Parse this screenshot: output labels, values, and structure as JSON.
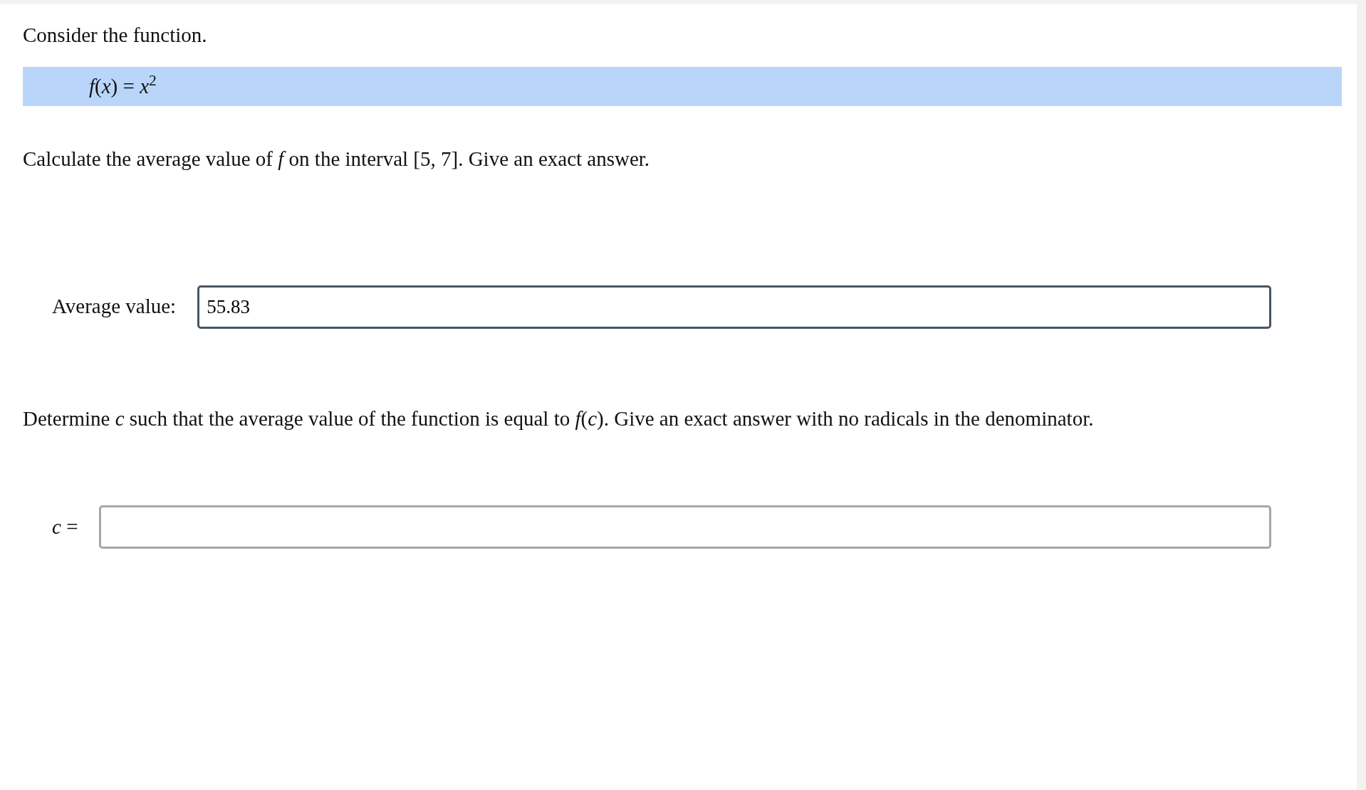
{
  "intro": "Consider the function.",
  "formula": "*f*(*x*) = *x*$^{2}$",
  "parts": [
    {
      "prompt": "Calculate the average value of *f* on the interval [5, 7]. Give an exact answer.",
      "label": "Average value:",
      "value": "55.83",
      "focused": true
    },
    {
      "prompt": "Determine *c* such that the average value of the function is equal to *f*(*c*). Give an exact answer with no radicals in the denominator.",
      "label": "*c* =",
      "focused": false
    }
  ]
}
